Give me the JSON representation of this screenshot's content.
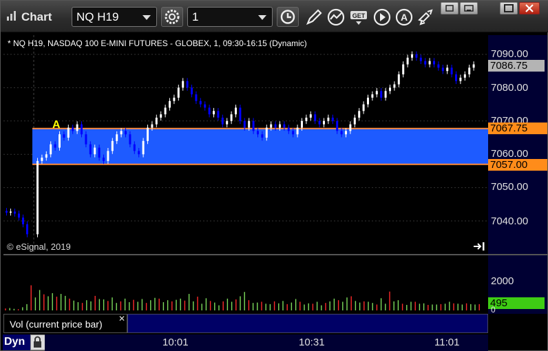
{
  "app": {
    "title": "Chart"
  },
  "toolbar": {
    "symbol_value": "NQ H19",
    "interval_value": "1",
    "icons": [
      "settings-gear-icon",
      "clock-icon",
      "pencil-draw-icon",
      "study-graph-icon",
      "get-data-icon",
      "play-icon",
      "alert-icon",
      "link-arrows-icon"
    ]
  },
  "window_controls": [
    "restore",
    "minimize",
    "maximize",
    "close"
  ],
  "chart": {
    "header": "* NQ H19, NASDAQ 100 E-MINI FUTURES - GLOBEX, 1, 09:30-16:15 (Dynamic)",
    "copyright": "© eSignal, 2019",
    "marker_label": "A",
    "price_axis": [
      "7090.00",
      "7080.00",
      "7070.00",
      "7060.00",
      "7050.00",
      "7040.00"
    ],
    "last_price": "7086.75",
    "zone_high": "7067.75",
    "zone_low": "7057.00",
    "volume_axis": [
      "2000",
      "0"
    ],
    "last_volume": "495",
    "volume_legend": "Vol (current price bar)",
    "time_axis": [
      "10:01",
      "10:31",
      "11:01"
    ],
    "mode": "Dyn"
  },
  "colors": {
    "zone_fill": "#1e5bff",
    "zone_line": "#ff8c3a",
    "up_candle": "#ffffff",
    "down_candle": "#0000ff",
    "vol_up": "#7ddc5c",
    "vol_down": "#ff2a2a",
    "axis_bg": "#000033",
    "last_price_tag": "#b4b4b4",
    "zone_tag": "#ff8c1a",
    "volume_tag": "#3ecc14",
    "marker": "#ffff00"
  }
}
